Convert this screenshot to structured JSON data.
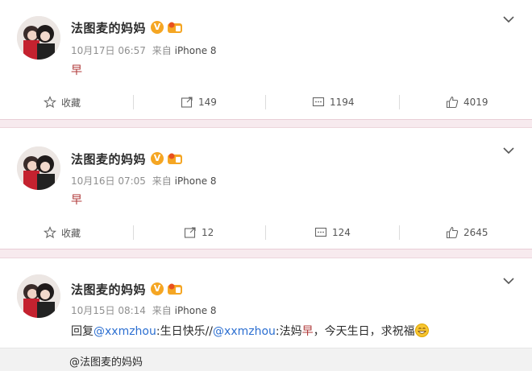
{
  "posts": [
    {
      "username": "法图麦的妈妈",
      "verified_badge": "V",
      "date": "10月17日 06:57",
      "source_prefix": "来自",
      "source": "iPhone 8",
      "content": "早",
      "actions": {
        "favorite_label": "收藏",
        "reposts": "149",
        "comments": "1194",
        "likes": "4019"
      }
    },
    {
      "username": "法图麦的妈妈",
      "verified_badge": "V",
      "date": "10月16日 07:05",
      "source_prefix": "来自",
      "source": "iPhone 8",
      "content": "早",
      "actions": {
        "favorite_label": "收藏",
        "reposts": "12",
        "comments": "124",
        "likes": "2645"
      }
    },
    {
      "username": "法图麦的妈妈",
      "verified_badge": "V",
      "date": "10月15日 08:14",
      "source_prefix": "来自",
      "source": "iPhone 8",
      "content": {
        "reply_prefix": "回复",
        "mention1": "@xxmzhou",
        "text1": ":生日快乐//",
        "mention2": "@xxmzhou",
        "text2": ":法妈",
        "highlight": "早",
        "text3": "，今天生日，求祝福"
      }
    }
  ],
  "reply_preview": "@法图麦的妈妈",
  "colors": {
    "badge": "#f5a623",
    "mention": "#2c6fd1",
    "divider": "#f7eaee"
  },
  "icons": [
    "star-icon",
    "repost-icon",
    "comment-icon",
    "like-icon",
    "chevron-down-icon",
    "verified-v-icon",
    "member-badge-icon",
    "grin-emoji-icon"
  ]
}
